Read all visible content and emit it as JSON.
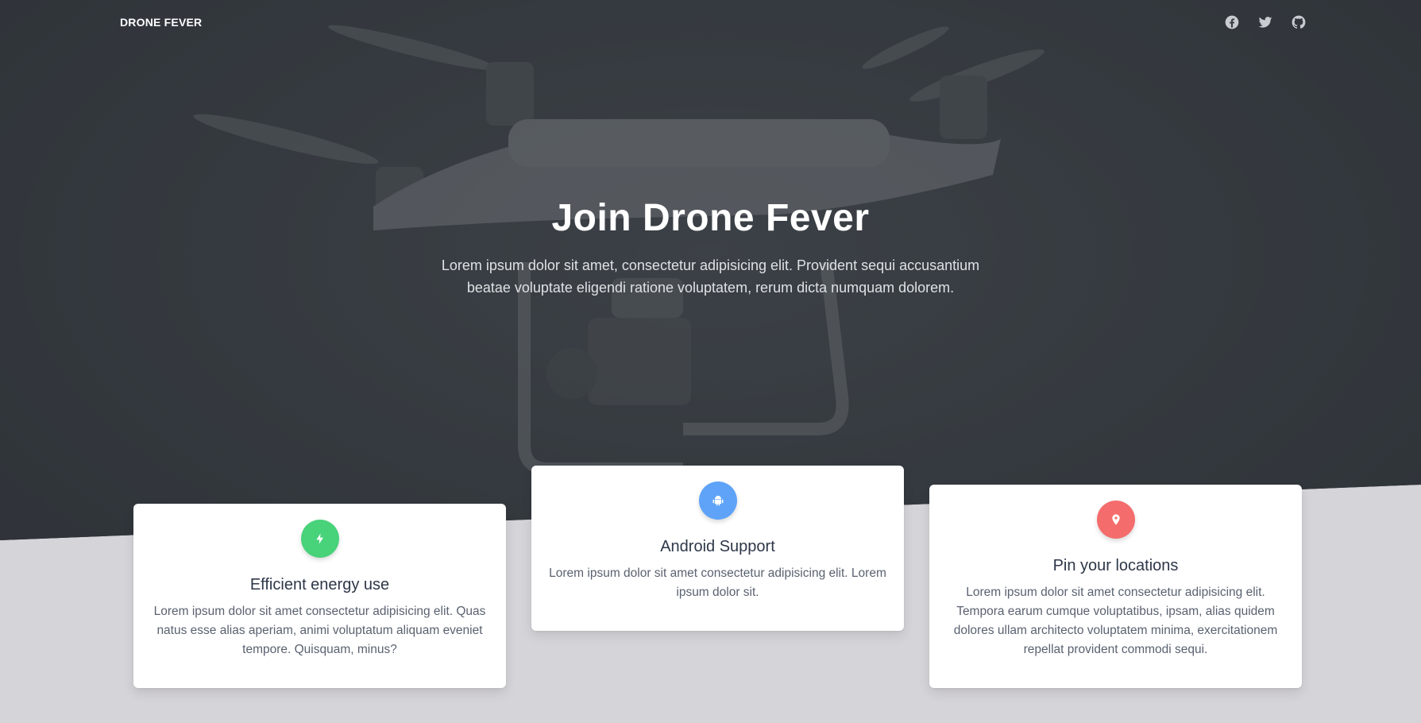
{
  "nav": {
    "brand": "DRONE FEVER",
    "social": [
      {
        "name": "facebook-icon"
      },
      {
        "name": "twitter-icon"
      },
      {
        "name": "github-icon"
      }
    ]
  },
  "hero": {
    "title": "Join Drone Fever",
    "subtitle": "Lorem ipsum dolor sit amet, consectetur adipisicing elit. Provident sequi accusantium beatae voluptate eligendi ratione voluptatem, rerum dicta numquam dolorem."
  },
  "features": [
    {
      "icon": "bolt-icon",
      "color": "#48d27a",
      "title": "Efficient energy use",
      "text": "Lorem ipsum dolor sit amet consectetur adipisicing elit. Quas natus esse alias aperiam, animi voluptatum aliquam eveniet tempore. Quisquam, minus?"
    },
    {
      "icon": "android-icon",
      "color": "#5ea3f8",
      "title": "Android Support",
      "text": "Lorem ipsum dolor sit amet consectetur adipisicing elit. Lorem ipsum dolor sit."
    },
    {
      "icon": "map-pin-icon",
      "color": "#f56c6c",
      "title": "Pin your locations",
      "text": "Lorem ipsum dolor sit amet consectetur adipisicing elit. Tempora earum cumque voluptatibus, ipsam, alias quidem dolores ullam architecto voluptatem minima, exercitationem repellat provident commodi sequi."
    }
  ]
}
